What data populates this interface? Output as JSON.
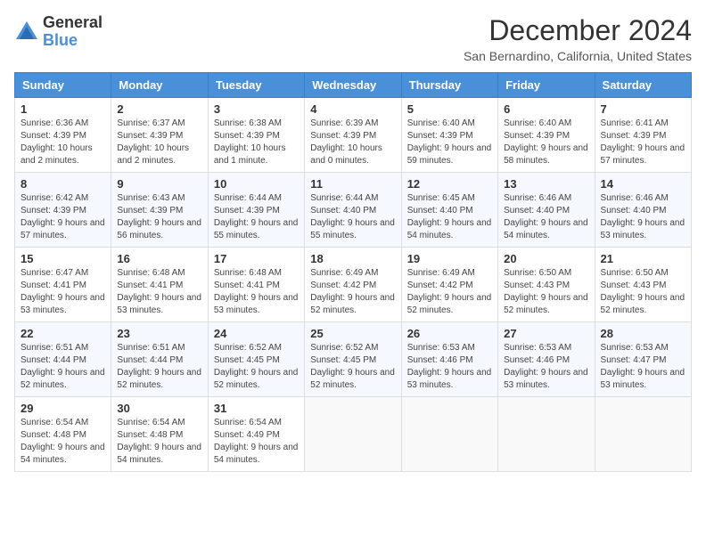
{
  "logo": {
    "general": "General",
    "blue": "Blue"
  },
  "title": "December 2024",
  "location": "San Bernardino, California, United States",
  "days_header": [
    "Sunday",
    "Monday",
    "Tuesday",
    "Wednesday",
    "Thursday",
    "Friday",
    "Saturday"
  ],
  "weeks": [
    [
      {
        "day": "1",
        "sunrise": "6:36 AM",
        "sunset": "4:39 PM",
        "daylight": "10 hours and 2 minutes."
      },
      {
        "day": "2",
        "sunrise": "6:37 AM",
        "sunset": "4:39 PM",
        "daylight": "10 hours and 2 minutes."
      },
      {
        "day": "3",
        "sunrise": "6:38 AM",
        "sunset": "4:39 PM",
        "daylight": "10 hours and 1 minute."
      },
      {
        "day": "4",
        "sunrise": "6:39 AM",
        "sunset": "4:39 PM",
        "daylight": "10 hours and 0 minutes."
      },
      {
        "day": "5",
        "sunrise": "6:40 AM",
        "sunset": "4:39 PM",
        "daylight": "9 hours and 59 minutes."
      },
      {
        "day": "6",
        "sunrise": "6:40 AM",
        "sunset": "4:39 PM",
        "daylight": "9 hours and 58 minutes."
      },
      {
        "day": "7",
        "sunrise": "6:41 AM",
        "sunset": "4:39 PM",
        "daylight": "9 hours and 57 minutes."
      }
    ],
    [
      {
        "day": "8",
        "sunrise": "6:42 AM",
        "sunset": "4:39 PM",
        "daylight": "9 hours and 57 minutes."
      },
      {
        "day": "9",
        "sunrise": "6:43 AM",
        "sunset": "4:39 PM",
        "daylight": "9 hours and 56 minutes."
      },
      {
        "day": "10",
        "sunrise": "6:44 AM",
        "sunset": "4:39 PM",
        "daylight": "9 hours and 55 minutes."
      },
      {
        "day": "11",
        "sunrise": "6:44 AM",
        "sunset": "4:40 PM",
        "daylight": "9 hours and 55 minutes."
      },
      {
        "day": "12",
        "sunrise": "6:45 AM",
        "sunset": "4:40 PM",
        "daylight": "9 hours and 54 minutes."
      },
      {
        "day": "13",
        "sunrise": "6:46 AM",
        "sunset": "4:40 PM",
        "daylight": "9 hours and 54 minutes."
      },
      {
        "day": "14",
        "sunrise": "6:46 AM",
        "sunset": "4:40 PM",
        "daylight": "9 hours and 53 minutes."
      }
    ],
    [
      {
        "day": "15",
        "sunrise": "6:47 AM",
        "sunset": "4:41 PM",
        "daylight": "9 hours and 53 minutes."
      },
      {
        "day": "16",
        "sunrise": "6:48 AM",
        "sunset": "4:41 PM",
        "daylight": "9 hours and 53 minutes."
      },
      {
        "day": "17",
        "sunrise": "6:48 AM",
        "sunset": "4:41 PM",
        "daylight": "9 hours and 53 minutes."
      },
      {
        "day": "18",
        "sunrise": "6:49 AM",
        "sunset": "4:42 PM",
        "daylight": "9 hours and 52 minutes."
      },
      {
        "day": "19",
        "sunrise": "6:49 AM",
        "sunset": "4:42 PM",
        "daylight": "9 hours and 52 minutes."
      },
      {
        "day": "20",
        "sunrise": "6:50 AM",
        "sunset": "4:43 PM",
        "daylight": "9 hours and 52 minutes."
      },
      {
        "day": "21",
        "sunrise": "6:50 AM",
        "sunset": "4:43 PM",
        "daylight": "9 hours and 52 minutes."
      }
    ],
    [
      {
        "day": "22",
        "sunrise": "6:51 AM",
        "sunset": "4:44 PM",
        "daylight": "9 hours and 52 minutes."
      },
      {
        "day": "23",
        "sunrise": "6:51 AM",
        "sunset": "4:44 PM",
        "daylight": "9 hours and 52 minutes."
      },
      {
        "day": "24",
        "sunrise": "6:52 AM",
        "sunset": "4:45 PM",
        "daylight": "9 hours and 52 minutes."
      },
      {
        "day": "25",
        "sunrise": "6:52 AM",
        "sunset": "4:45 PM",
        "daylight": "9 hours and 52 minutes."
      },
      {
        "day": "26",
        "sunrise": "6:53 AM",
        "sunset": "4:46 PM",
        "daylight": "9 hours and 53 minutes."
      },
      {
        "day": "27",
        "sunrise": "6:53 AM",
        "sunset": "4:46 PM",
        "daylight": "9 hours and 53 minutes."
      },
      {
        "day": "28",
        "sunrise": "6:53 AM",
        "sunset": "4:47 PM",
        "daylight": "9 hours and 53 minutes."
      }
    ],
    [
      {
        "day": "29",
        "sunrise": "6:54 AM",
        "sunset": "4:48 PM",
        "daylight": "9 hours and 54 minutes."
      },
      {
        "day": "30",
        "sunrise": "6:54 AM",
        "sunset": "4:48 PM",
        "daylight": "9 hours and 54 minutes."
      },
      {
        "day": "31",
        "sunrise": "6:54 AM",
        "sunset": "4:49 PM",
        "daylight": "9 hours and 54 minutes."
      },
      null,
      null,
      null,
      null
    ]
  ]
}
